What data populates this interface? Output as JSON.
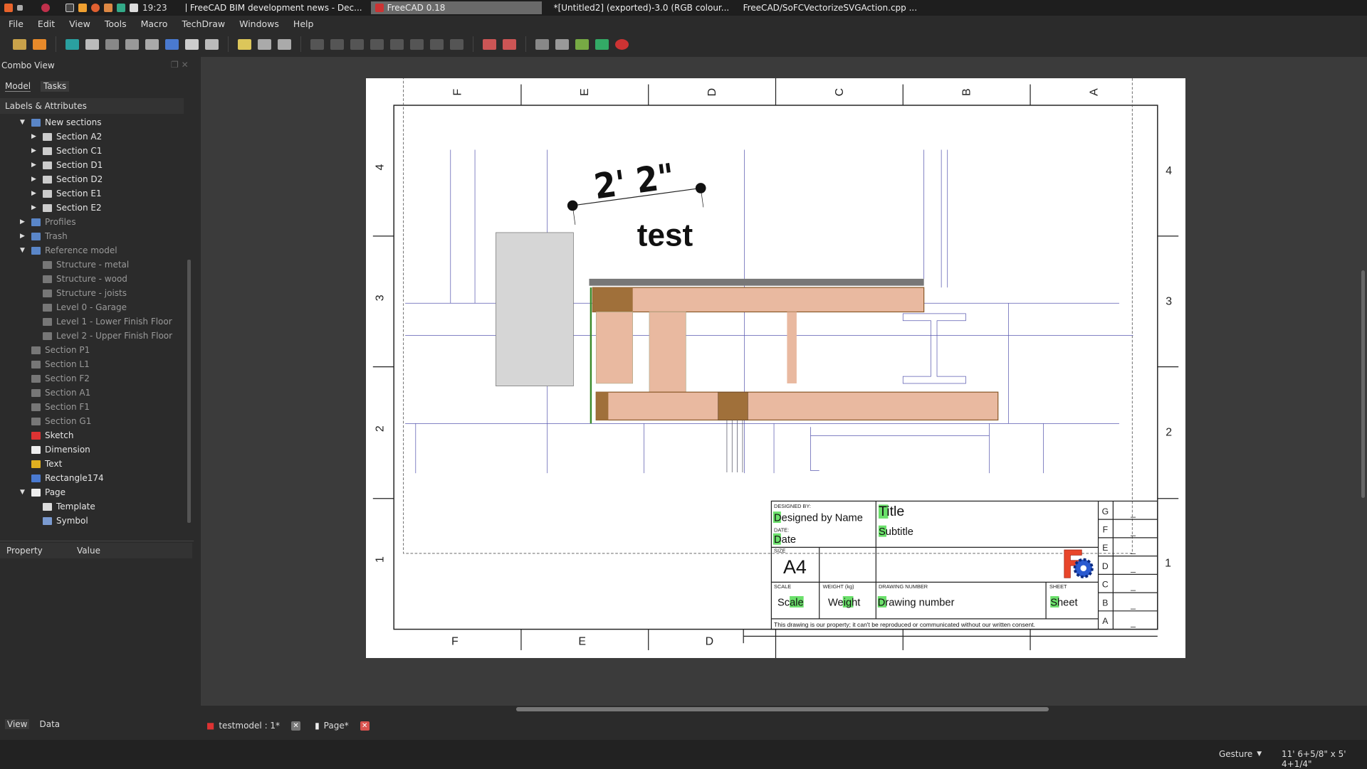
{
  "taskbar": {
    "clock": "19:23",
    "tasks": [
      "FreeCAD BIM development news - Dec...",
      "FreeCAD 0.18",
      "*[Untitled2] (exported)-3.0 (RGB colour...",
      "FreeCAD/SoFCVectorizeSVGAction.cpp ..."
    ]
  },
  "menu": [
    "File",
    "Edit",
    "View",
    "Tools",
    "Macro",
    "TechDraw",
    "Windows",
    "Help"
  ],
  "combo": {
    "title": "Combo View",
    "tabs": [
      "Model",
      "Tasks"
    ],
    "header": "Labels & Attributes",
    "tree": [
      {
        "label": "New sections",
        "level": 1,
        "arrow": "down",
        "icon": "folder-icon",
        "dim": false
      },
      {
        "label": "Section A2",
        "level": 2,
        "arrow": "right",
        "icon": "section-icon",
        "dim": false
      },
      {
        "label": "Section C1",
        "level": 2,
        "arrow": "right",
        "icon": "section-icon",
        "dim": false
      },
      {
        "label": "Section D1",
        "level": 2,
        "arrow": "right",
        "icon": "section-icon",
        "dim": false
      },
      {
        "label": "Section D2",
        "level": 2,
        "arrow": "right",
        "icon": "section-icon",
        "dim": false
      },
      {
        "label": "Section E1",
        "level": 2,
        "arrow": "right",
        "icon": "section-icon",
        "dim": false
      },
      {
        "label": "Section E2",
        "level": 2,
        "arrow": "right",
        "icon": "section-icon",
        "dim": false
      },
      {
        "label": "Profiles",
        "level": 1,
        "arrow": "right",
        "icon": "folder-icon",
        "dim": true
      },
      {
        "label": "Trash",
        "level": 1,
        "arrow": "right",
        "icon": "folder-icon",
        "dim": true
      },
      {
        "label": "Reference model",
        "level": 1,
        "arrow": "down",
        "icon": "folder-icon",
        "dim": true
      },
      {
        "label": "Structure - metal",
        "level": 2,
        "arrow": "",
        "icon": "part-icon",
        "dim": true
      },
      {
        "label": "Structure - wood",
        "level": 2,
        "arrow": "",
        "icon": "part-icon",
        "dim": true
      },
      {
        "label": "Structure - joists",
        "level": 2,
        "arrow": "",
        "icon": "part-icon",
        "dim": true
      },
      {
        "label": "Level 0 - Garage",
        "level": 2,
        "arrow": "",
        "icon": "part-icon",
        "dim": true
      },
      {
        "label": "Level 1 - Lower Finish Floor",
        "level": 2,
        "arrow": "",
        "icon": "part-icon",
        "dim": true
      },
      {
        "label": "Level 2 - Upper Finish Floor",
        "level": 2,
        "arrow": "",
        "icon": "part-icon",
        "dim": true
      },
      {
        "label": "Section P1",
        "level": 1,
        "arrow": "",
        "icon": "part-icon",
        "dim": true
      },
      {
        "label": "Section L1",
        "level": 1,
        "arrow": "",
        "icon": "part-icon",
        "dim": true
      },
      {
        "label": "Section F2",
        "level": 1,
        "arrow": "",
        "icon": "part-icon",
        "dim": true
      },
      {
        "label": "Section A1",
        "level": 1,
        "arrow": "",
        "icon": "part-icon",
        "dim": true
      },
      {
        "label": "Section F1",
        "level": 1,
        "arrow": "",
        "icon": "part-icon",
        "dim": true
      },
      {
        "label": "Section G1",
        "level": 1,
        "arrow": "",
        "icon": "part-icon",
        "dim": true
      },
      {
        "label": "Sketch",
        "level": 1,
        "arrow": "",
        "icon": "sketch-icon",
        "dim": false
      },
      {
        "label": "Dimension",
        "level": 1,
        "arrow": "",
        "icon": "dimension-icon",
        "dim": false
      },
      {
        "label": "Text",
        "level": 1,
        "arrow": "",
        "icon": "text-icon",
        "dim": false
      },
      {
        "label": "Rectangle174",
        "level": 1,
        "arrow": "",
        "icon": "rectangle-icon",
        "dim": false
      },
      {
        "label": "Page",
        "level": 1,
        "arrow": "down",
        "icon": "page-icon",
        "dim": false
      },
      {
        "label": "Template",
        "level": 2,
        "arrow": "",
        "icon": "template-icon",
        "dim": false
      },
      {
        "label": "Symbol",
        "level": 2,
        "arrow": "",
        "icon": "symbol-icon",
        "dim": false
      }
    ],
    "property_headers": [
      "Property",
      "Value"
    ],
    "bottom_tabs": [
      "View",
      "Data"
    ]
  },
  "drawing": {
    "col_labels": [
      "F",
      "E",
      "D",
      "C",
      "B",
      "A"
    ],
    "row_labels": [
      "4",
      "3",
      "2",
      "1"
    ],
    "dimension": "2' 2\"",
    "annotation": "test",
    "titleblock": {
      "designed_by_label": "DESIGNED BY:",
      "designed_by": "Designed by Name",
      "date_label": "DATE:",
      "date": "Date",
      "title": "Title",
      "subtitle": "Subtitle",
      "size_label": "SIZE",
      "size": "A4",
      "scale_label": "SCALE",
      "scale": "Scale",
      "weight_label": "WEIGHT (kg)",
      "weight": "Weight",
      "drawing_number_label": "DRAWING NUMBER",
      "drawing_number": "Drawing number",
      "sheet_label": "SHEET",
      "sheet": "Sheet",
      "notice": "This drawing is our property; it can't be reproduced or communicated without our written consent.",
      "revisions": [
        "G",
        "F",
        "E",
        "D",
        "C",
        "B",
        "A"
      ],
      "revision_values": [
        "_",
        "_",
        "_",
        "_",
        "_",
        "_",
        "_"
      ]
    }
  },
  "doc_tabs": [
    "testmodel : 1*",
    "Page*"
  ],
  "status": {
    "navigation": "Gesture",
    "dimensions": "11' 6+5/8\" x 5' 4+1/4\""
  }
}
